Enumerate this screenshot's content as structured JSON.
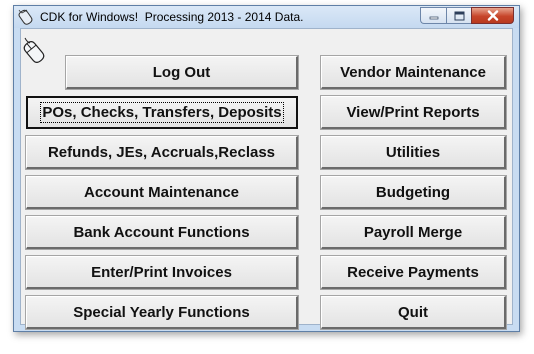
{
  "window": {
    "title": "CDK for Windows!  Processing 2013 - 2014 Data.",
    "icons": {
      "title": "mouse-icon",
      "app": "mouse-icon",
      "minimize": "minimize-icon",
      "maximize": "maximize-icon",
      "close": "close-icon"
    },
    "colors": {
      "frame": "#c8dcf2",
      "client": "#f0f0f0",
      "close_button": "#c7452a"
    }
  },
  "buttons": {
    "logout": "Log Out",
    "pos_checks": "POs, Checks, Transfers, Deposits",
    "refunds": "Refunds, JEs, Accruals,Reclass",
    "account_maintenance": "Account Maintenance",
    "bank_account_functions": "Bank Account Functions",
    "enter_print_invoices": "Enter/Print Invoices",
    "special_yearly_functions": "Special Yearly Functions",
    "vendor_maintenance": "Vendor Maintenance",
    "view_print_reports": "View/Print Reports",
    "utilities": "Utilities",
    "budgeting": "Budgeting",
    "payroll_merge": "Payroll Merge",
    "receive_payments": "Receive Payments",
    "quit": "Quit"
  },
  "focused_button": "pos_checks"
}
